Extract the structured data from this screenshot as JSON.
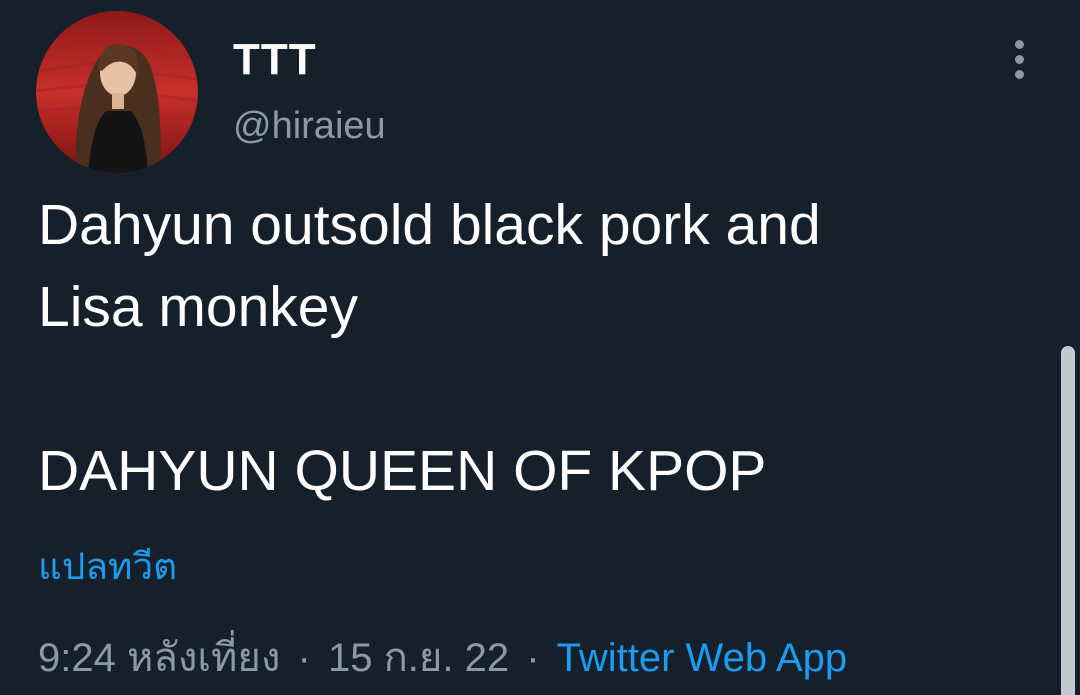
{
  "author": {
    "display_name": "TTT",
    "handle": "@hiraieu"
  },
  "tweet": {
    "lines": [
      "Dahyun outsold black pork and",
      "Lisa monkey",
      "DAHYUN QUEEN OF KPOP"
    ],
    "translate_label": "แปลทวีต"
  },
  "meta": {
    "time": "9:24 หลังเที่ยง",
    "separator": "·",
    "date": "15 ก.ย. 22",
    "source": "Twitter Web App"
  },
  "icons": {
    "more": "more-vertical-icon"
  },
  "colors": {
    "background": "#15202b",
    "text_primary": "#ffffff",
    "text_secondary": "#8b98a5",
    "accent": "#1d9bf0"
  }
}
